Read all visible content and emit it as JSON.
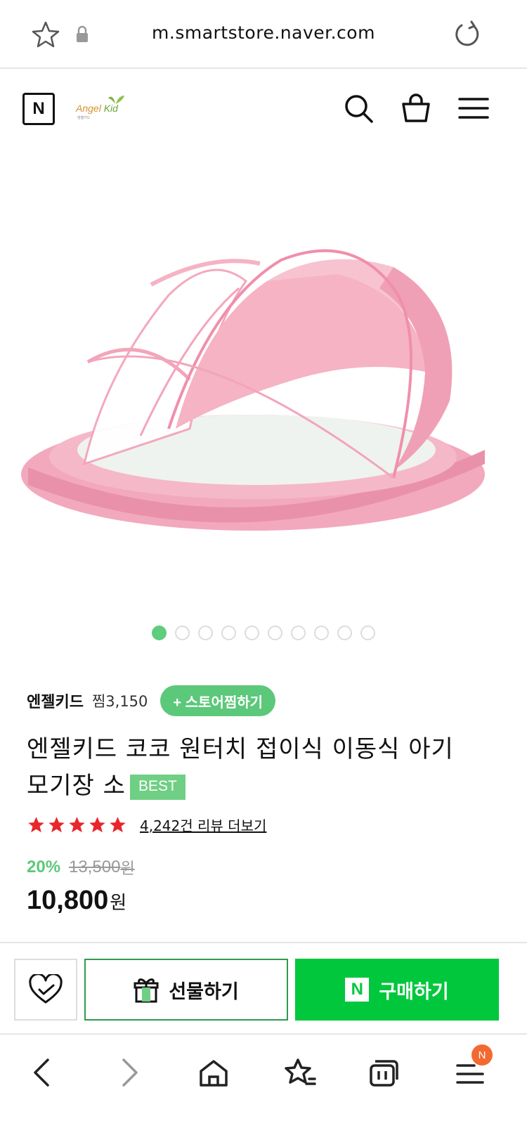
{
  "browser": {
    "url": "m.smartstore.naver.com",
    "icons": [
      "star-icon",
      "lock-icon",
      "reload-icon"
    ]
  },
  "header": {
    "naver_logo": "N",
    "brand_logo_text": "Angel",
    "brand_logo_text2": "Kid",
    "brand_logo_sub": "엔젤키드",
    "icons": [
      "search-icon",
      "shopping-bag-icon",
      "hamburger-menu-icon"
    ]
  },
  "gallery": {
    "total_images": 10,
    "current_index": 1,
    "image_subject": "pink foldable baby mosquito net canopy"
  },
  "store": {
    "name": "엔젤키드",
    "wish_count": "찜3,150",
    "wish_button": "+ 스토어찜하기"
  },
  "product": {
    "title": "엔젤키드 코코 원터치 접이식 이동식 아기 모기장 소",
    "badge": "BEST",
    "rating_stars": 5,
    "review_link": "4,242건 리뷰 더보기",
    "discount_rate": "20%",
    "original_price": "13,500",
    "original_price_unit": "원",
    "price": "10,800",
    "price_unit": "원"
  },
  "actions": {
    "gift_label": "선물하기",
    "buy_label": "구매하기",
    "buy_icon_text": "N"
  },
  "nav": {
    "badge": "N",
    "items": [
      "back-icon",
      "forward-icon",
      "home-icon",
      "bookmarks-icon",
      "tabs-icon",
      "menu-icon"
    ]
  },
  "colors": {
    "brand_green": "#00c73c",
    "accent_green": "#5cc87a",
    "star_red": "#e8262c",
    "pink": "#f2a9bd",
    "badge_orange": "#f26a30"
  }
}
